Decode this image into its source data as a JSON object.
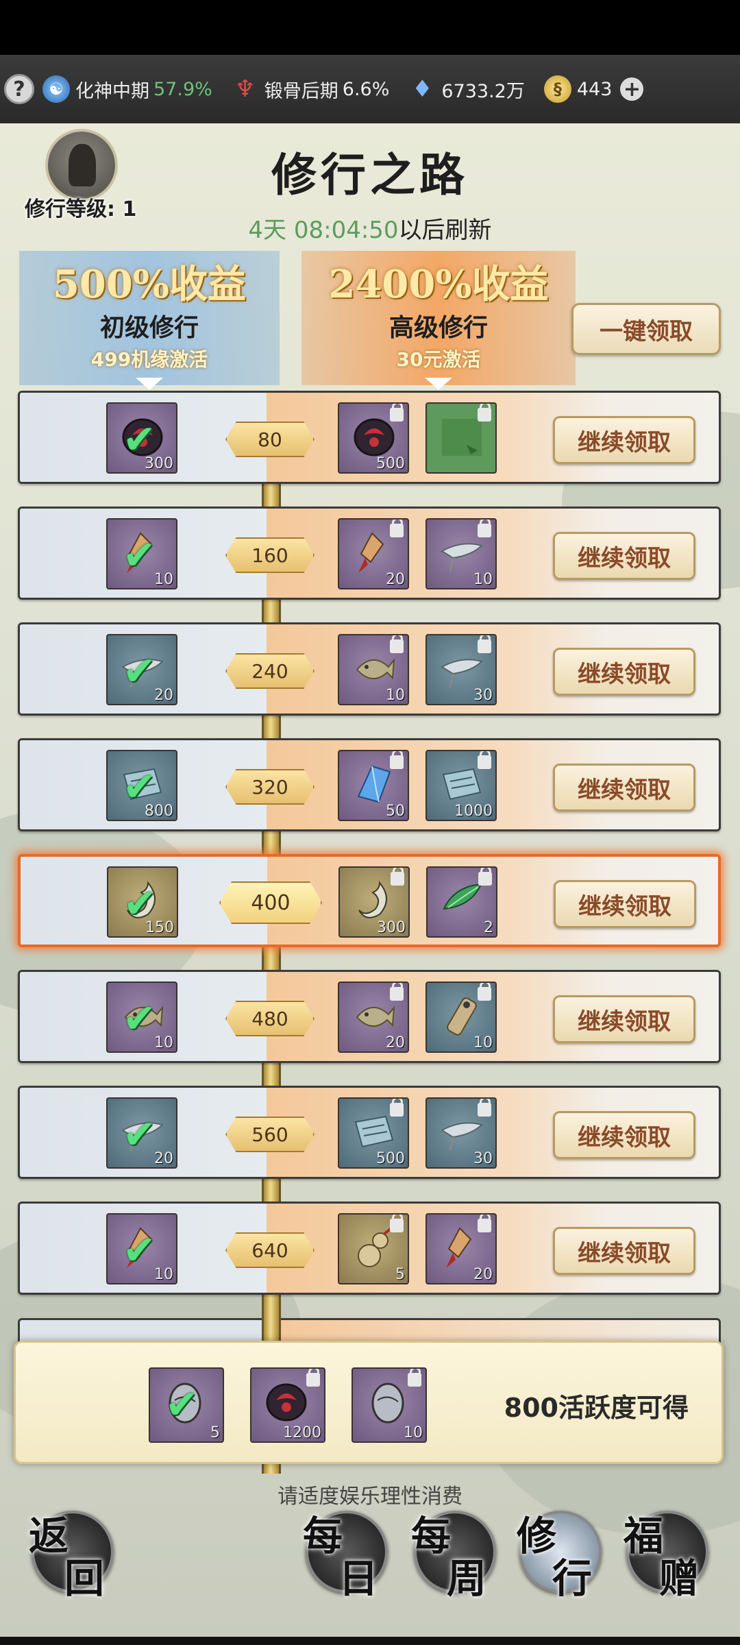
{
  "status": {
    "realm": {
      "label": "化神中期",
      "pct": "57.9%"
    },
    "body": {
      "label": "锻骨后期",
      "pct": "6.6%"
    },
    "spirit_stones": "6733.2万",
    "currency": "443"
  },
  "header": {
    "title": "修行之路",
    "level_label": "修行等级: 1",
    "refresh_time": "4天 08:04:50",
    "refresh_suffix": "以后刷新"
  },
  "tiers": {
    "basic": {
      "bonus": "500%收益",
      "name": "初级修行",
      "activation": "499机缘激活"
    },
    "advanced": {
      "bonus": "2400%收益",
      "name": "高级修行",
      "activation": "30元激活"
    }
  },
  "claim_all_label": "一键领取",
  "rows": [
    {
      "milestone": "80",
      "basic": {
        "icon": "mark-stone-icon",
        "color": "purple",
        "count": "300",
        "claimed": true
      },
      "adv": [
        {
          "icon": "mark-stone-icon",
          "color": "purple",
          "count": "500"
        },
        {
          "icon": "green-chest-icon",
          "color": "green",
          "count": ""
        }
      ],
      "claim": "继续领取"
    },
    {
      "milestone": "160",
      "basic": {
        "icon": "talisman-tassel-icon",
        "color": "purple",
        "count": "10",
        "claimed": true
      },
      "adv": [
        {
          "icon": "talisman-tassel-icon",
          "color": "purple",
          "count": "20"
        },
        {
          "icon": "flying-sword-boat-icon",
          "color": "purple",
          "count": "10"
        }
      ],
      "claim": "继续领取"
    },
    {
      "milestone": "240",
      "basic": {
        "icon": "flying-sword-boat-icon",
        "color": "blue",
        "count": "20",
        "claimed": true
      },
      "adv": [
        {
          "icon": "fish-spirit-icon",
          "color": "purple",
          "count": "10"
        },
        {
          "icon": "flying-sword-boat-icon",
          "color": "blue",
          "count": "30"
        }
      ],
      "claim": "继续领取"
    },
    {
      "milestone": "320",
      "basic": {
        "icon": "scroll-map-icon",
        "color": "blue",
        "count": "800",
        "claimed": true
      },
      "adv": [
        {
          "icon": "crystal-shard-icon",
          "color": "purple",
          "count": "50"
        },
        {
          "icon": "scroll-map-icon",
          "color": "blue",
          "count": "1000"
        }
      ],
      "claim": "继续领取"
    },
    {
      "milestone": "400",
      "basic": {
        "icon": "hook-jade-icon",
        "color": "gold",
        "count": "150",
        "claimed": true
      },
      "adv": [
        {
          "icon": "hook-jade-icon",
          "color": "gold",
          "count": "300"
        },
        {
          "icon": "spirit-herb-icon",
          "color": "purple",
          "count": "2"
        }
      ],
      "claim": "继续领取",
      "highlight": true
    },
    {
      "milestone": "480",
      "basic": {
        "icon": "fish-spirit-icon",
        "color": "purple",
        "count": "10",
        "claimed": true
      },
      "adv": [
        {
          "icon": "fish-spirit-icon",
          "color": "purple",
          "count": "20"
        },
        {
          "icon": "jade-scroll-icon",
          "color": "blue",
          "count": "10"
        }
      ],
      "claim": "继续领取"
    },
    {
      "milestone": "560",
      "basic": {
        "icon": "flying-sword-boat-icon",
        "color": "blue",
        "count": "20",
        "claimed": true
      },
      "adv": [
        {
          "icon": "scroll-map-icon",
          "color": "blue",
          "count": "500"
        },
        {
          "icon": "flying-sword-boat-icon",
          "color": "blue",
          "count": "30"
        }
      ],
      "claim": "继续领取"
    },
    {
      "milestone": "640",
      "basic": {
        "icon": "talisman-tassel-icon",
        "color": "purple",
        "count": "10",
        "claimed": true
      },
      "adv": [
        {
          "icon": "gourd-icon",
          "color": "gold",
          "count": "5"
        },
        {
          "icon": "talisman-tassel-icon",
          "color": "purple",
          "count": "20"
        }
      ],
      "claim": "继续领取"
    }
  ],
  "bonus": {
    "items": [
      {
        "icon": "spirit-egg-icon",
        "color": "purple",
        "count": "5",
        "claimed": true
      },
      {
        "icon": "mark-stone-icon",
        "color": "purple",
        "count": "1200"
      },
      {
        "icon": "spirit-egg-icon",
        "color": "purple",
        "count": "10"
      }
    ],
    "text": "800活跃度可得"
  },
  "notice": "请适度娱乐理性消费",
  "nav": {
    "back": [
      "返",
      "回"
    ],
    "daily": [
      "每",
      "日"
    ],
    "weekly": [
      "每",
      "周"
    ],
    "practice": [
      "修",
      "行"
    ],
    "gift": [
      "福",
      "赠"
    ]
  }
}
